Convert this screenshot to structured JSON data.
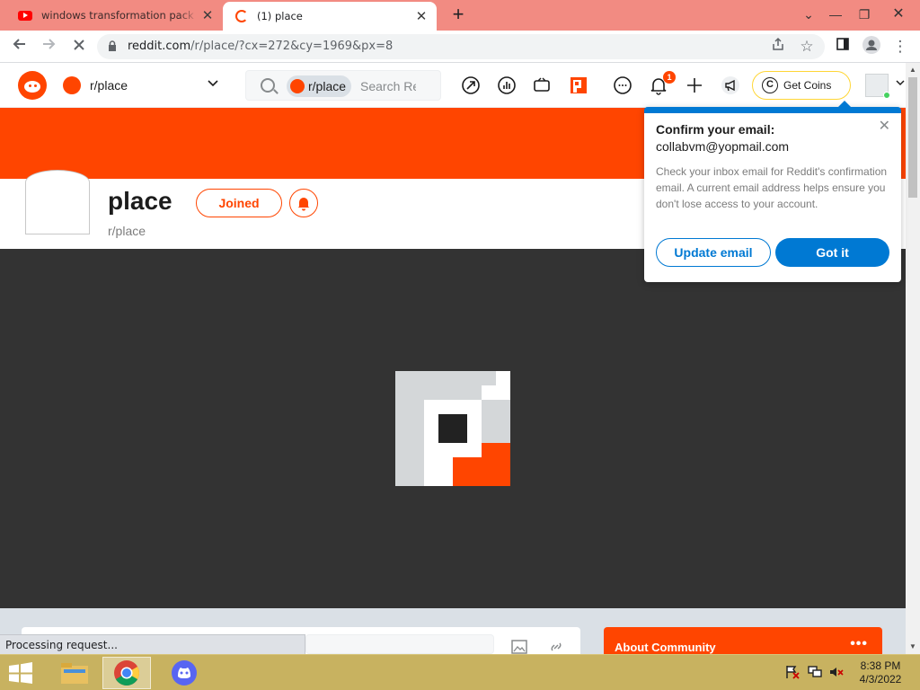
{
  "browser": {
    "tabs": [
      {
        "title": "windows transformation pack - Y",
        "icon": "youtube-icon",
        "active": false
      },
      {
        "title": "(1) place",
        "icon": "reddit-loading-icon",
        "active": true
      }
    ],
    "url_host": "reddit.com",
    "url_path": "/r/place/?cx=272&cy=1969&px=8",
    "status_text": "Processing request..."
  },
  "reddit": {
    "community_selector": "r/place",
    "search_chip": "r/place",
    "search_placeholder": "Search Reddit",
    "notifications_count": "1",
    "get_coins": "Get Coins",
    "community": {
      "title": "place",
      "name": "r/place",
      "joined_label": "Joined"
    },
    "about_community": "About Community",
    "about_dots": "•••"
  },
  "popup": {
    "title": "Confirm your email:",
    "email": "collabvm@yopmail.com",
    "body": "Check your inbox email for Reddit's confirmation email. A current email address helps ensure you don't lose access to your account.",
    "update_label": "Update email",
    "got_it_label": "Got it"
  },
  "taskbar": {
    "time": "8:38 PM",
    "date": "4/3/2022"
  },
  "colors": {
    "reddit_orange": "#ff4500",
    "reddit_blue": "#0079d3",
    "canvas_bg": "#333333",
    "tab_strip": "#f28b82",
    "taskbar": "#c8b260"
  }
}
